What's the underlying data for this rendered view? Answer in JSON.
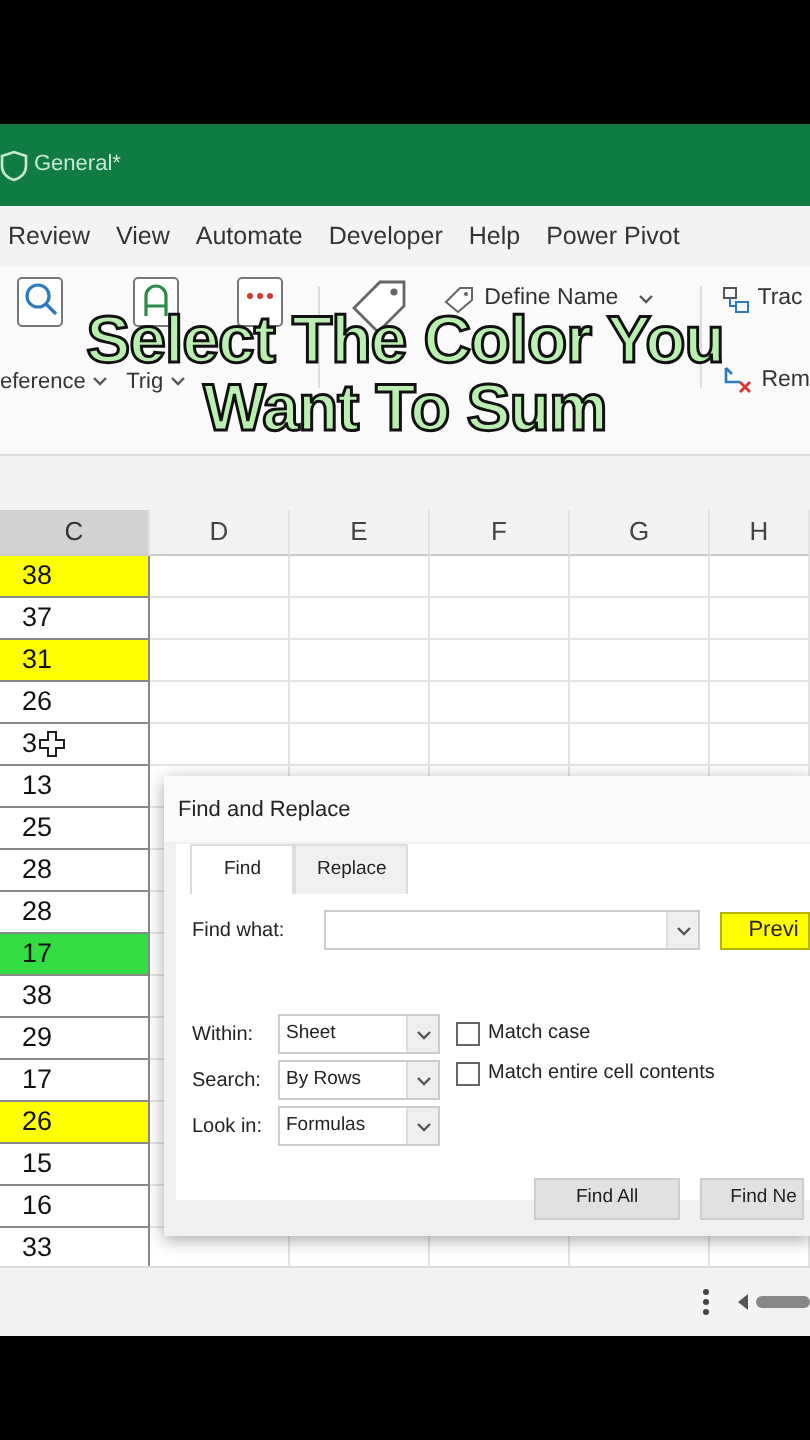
{
  "title_bar": {
    "label": "General*"
  },
  "ribbon_tabs": [
    {
      "label": "Review",
      "selected": false
    },
    {
      "label": "View",
      "selected": false
    },
    {
      "label": "Automate",
      "selected": false
    },
    {
      "label": "Developer",
      "selected": false
    },
    {
      "label": "Help",
      "selected": false
    },
    {
      "label": "Power Pivot",
      "selected": false
    }
  ],
  "ribbon_big": [
    {
      "kind": "lookup",
      "label": "eference",
      "dropdown": true
    },
    {
      "kind": "trig",
      "label": "Trig",
      "dropdown": true
    },
    {
      "kind": "more"
    },
    {
      "kind": "tag"
    }
  ],
  "ribbon_small": [
    {
      "kind": "tag",
      "label": "Define Name",
      "dropdown": true
    }
  ],
  "ribbon_right": [
    {
      "kind": "trace",
      "label": "Trac"
    },
    {
      "kind": "remove",
      "label": "Rem"
    }
  ],
  "caption": [
    "Select The Color You",
    "Want To Sum"
  ],
  "columns": [
    "C",
    "D",
    "E",
    "F",
    "G",
    "H"
  ],
  "cells": [
    {
      "value": "38",
      "color": "#ffff00"
    },
    {
      "value": "37"
    },
    {
      "value": "31",
      "color": "#ffff00"
    },
    {
      "value": "26"
    },
    {
      "value": "3",
      "cursor": true
    },
    {
      "value": "13"
    },
    {
      "value": "25"
    },
    {
      "value": "28"
    },
    {
      "value": "28"
    },
    {
      "value": "17",
      "color": "#33dd44"
    },
    {
      "value": "38"
    },
    {
      "value": "29"
    },
    {
      "value": "17"
    },
    {
      "value": "26",
      "color": "#ffff00"
    },
    {
      "value": "15"
    },
    {
      "value": "16"
    },
    {
      "value": "33"
    }
  ],
  "dialog": {
    "title": "Find and Replace",
    "tabs": [
      {
        "label": "Find",
        "selected": true
      },
      {
        "label": "Replace",
        "selected": false
      }
    ],
    "find_what": {
      "label": "Find what:"
    },
    "format_button": "Previ",
    "options": [
      {
        "label": "Within:",
        "value": "Sheet"
      },
      {
        "label": "Search:",
        "value": "By Rows"
      },
      {
        "label": "Look in:",
        "value": "Formulas"
      }
    ],
    "checkboxes": [
      {
        "label": "Match case",
        "checked": false
      },
      {
        "label": "Match entire cell contents",
        "checked": false
      }
    ],
    "buttons": [
      "Find All",
      "Find Ne"
    ]
  }
}
